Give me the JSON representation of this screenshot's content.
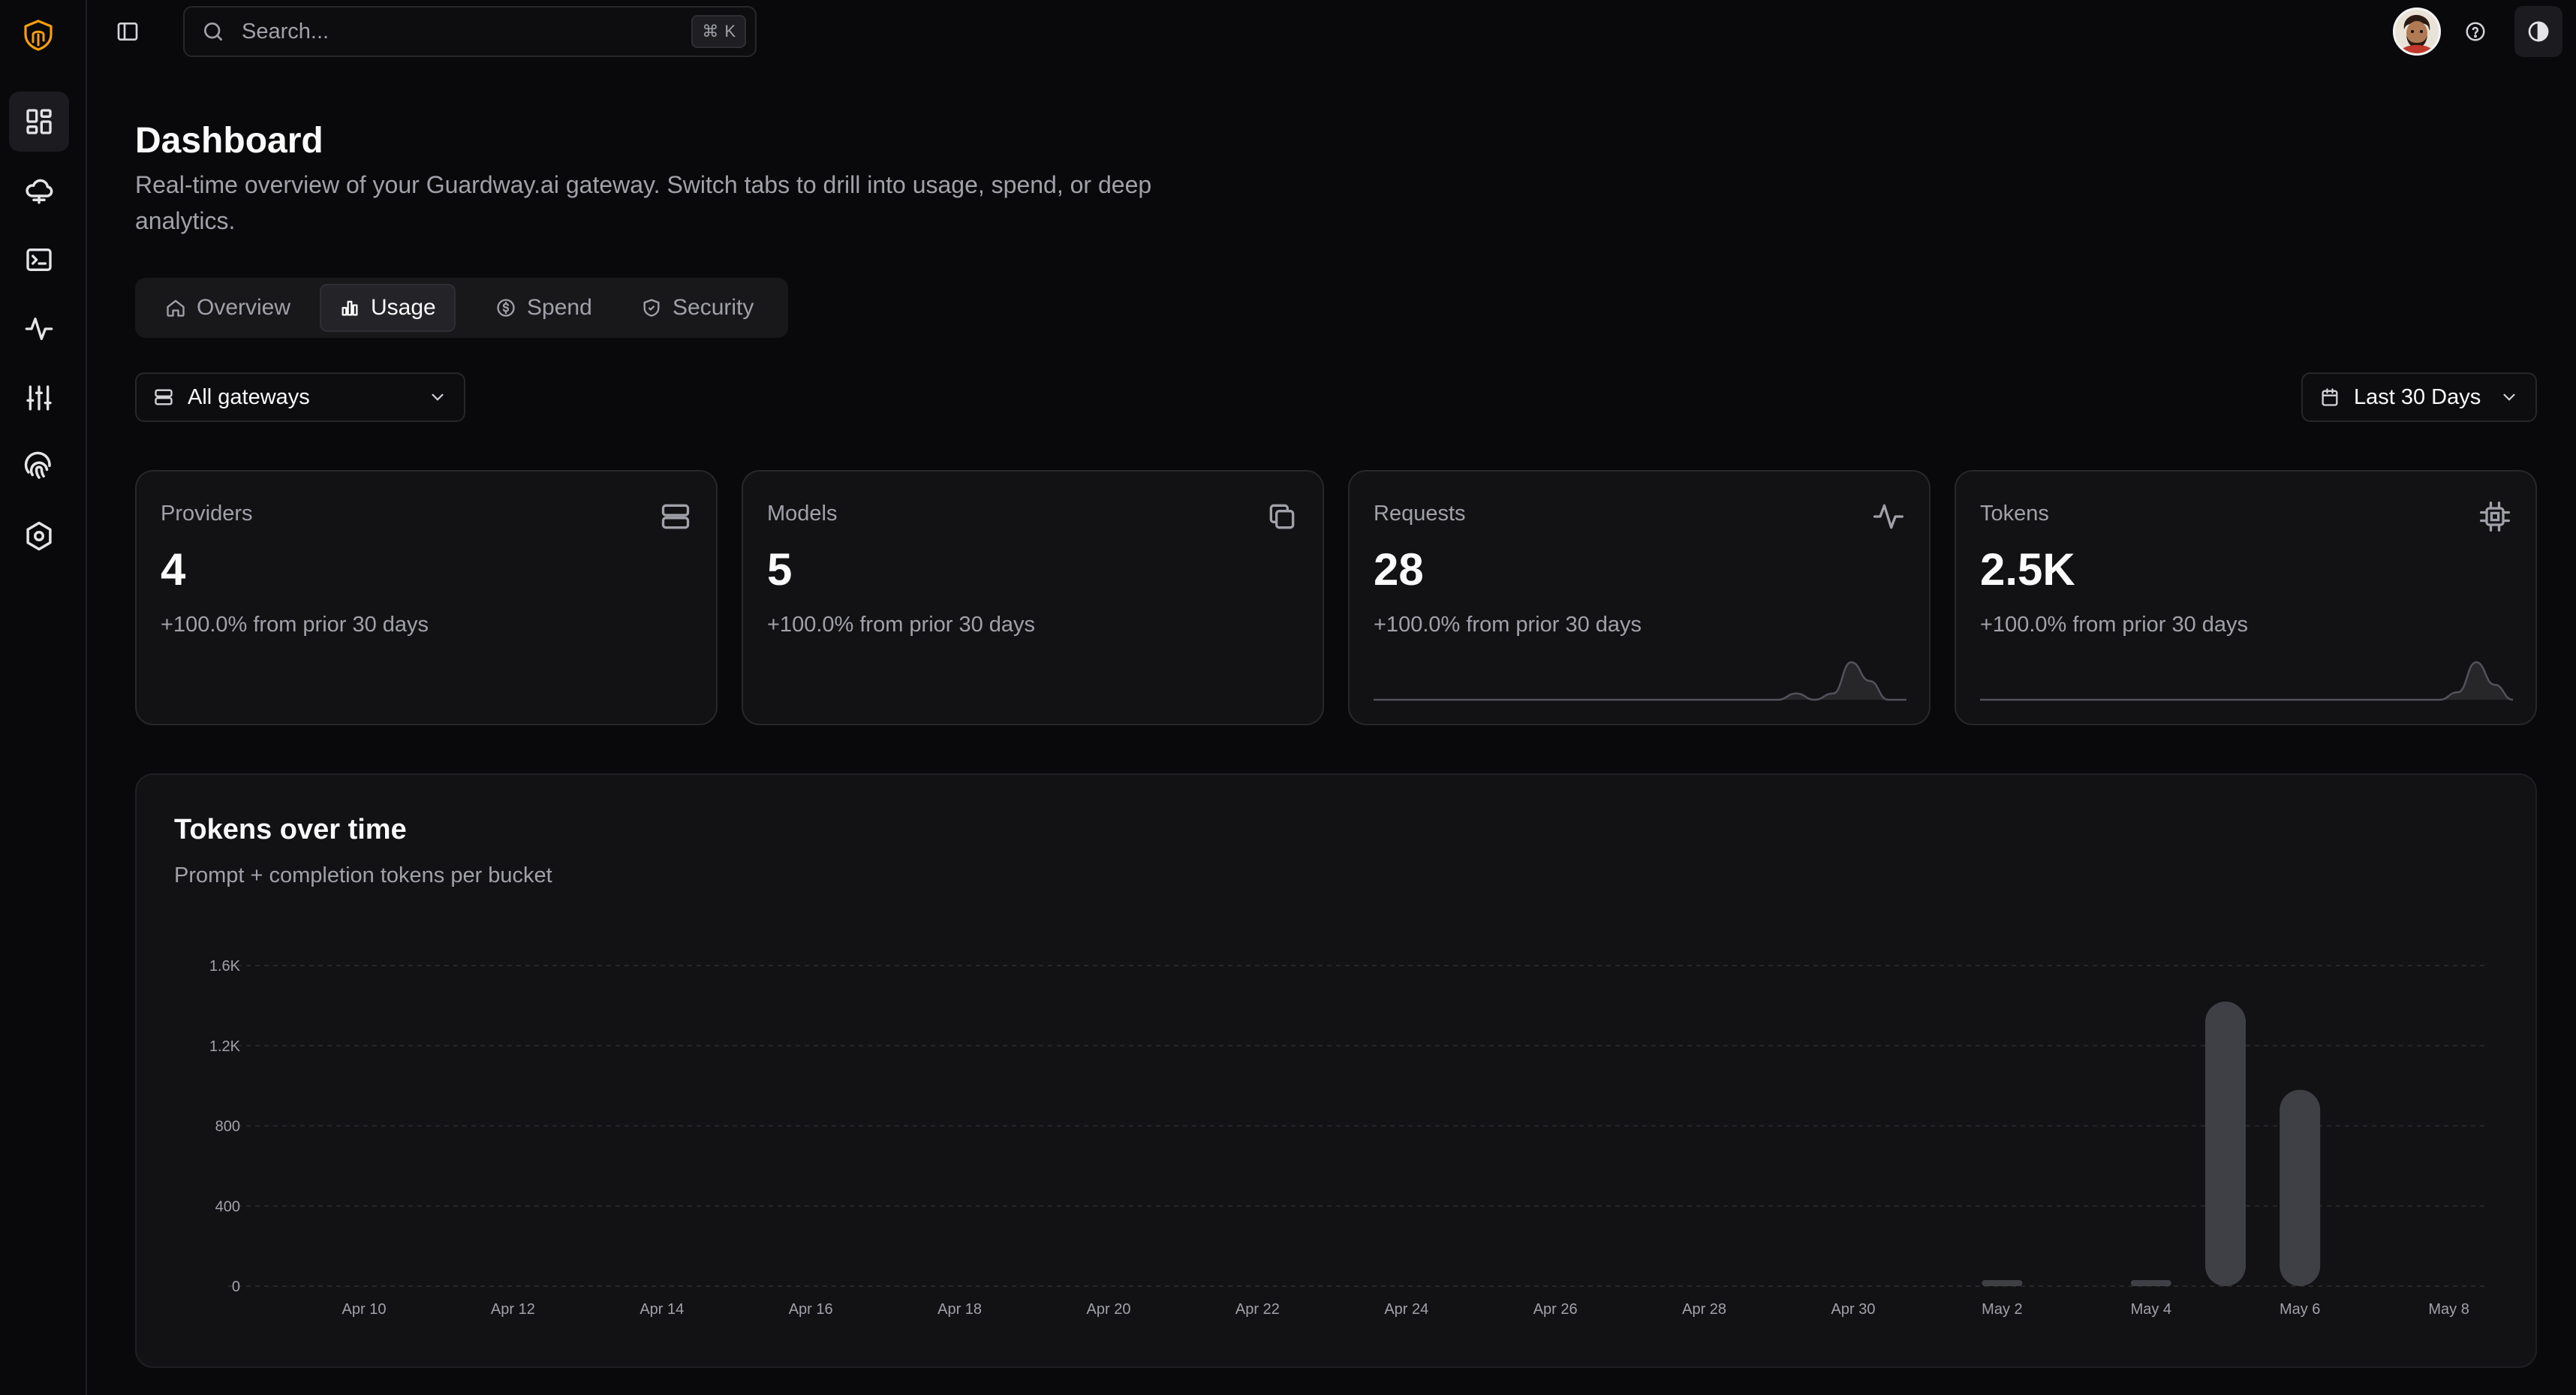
{
  "sidebar": {
    "logo": "guardway-logo-icon",
    "items": [
      {
        "icon": "dashboard-icon",
        "active": true
      },
      {
        "icon": "cloud-icon",
        "active": false
      },
      {
        "icon": "terminal-icon",
        "active": false
      },
      {
        "icon": "activity-icon",
        "active": false
      },
      {
        "icon": "sliders-icon",
        "active": false
      },
      {
        "icon": "fingerprint-icon",
        "active": false
      },
      {
        "icon": "settings-hex-icon",
        "active": false
      }
    ]
  },
  "topbar": {
    "search_placeholder": "Search...",
    "shortcut_symbol": "⌘",
    "shortcut_key": "K"
  },
  "page": {
    "title": "Dashboard",
    "subtitle": "Real-time overview of your Guardway.ai gateway. Switch tabs to drill into usage, spend, or deep analytics."
  },
  "tabs": [
    {
      "label": "Overview",
      "icon": "home-icon",
      "active": false
    },
    {
      "label": "Usage",
      "icon": "bar-chart-icon",
      "active": true
    },
    {
      "label": "Spend",
      "icon": "dollar-circle-icon",
      "active": false
    },
    {
      "label": "Security",
      "icon": "shield-icon",
      "active": false
    }
  ],
  "filters": {
    "gateway": "All gateways",
    "range": "Last 30 Days"
  },
  "cards": [
    {
      "label": "Providers",
      "value": "4",
      "change": "+100.0% from prior 30 days",
      "icon": "server-icon"
    },
    {
      "label": "Models",
      "value": "5",
      "change": "+100.0% from prior 30 days",
      "icon": "copy-icon"
    },
    {
      "label": "Requests",
      "value": "28",
      "change": "+100.0% from prior 30 days",
      "icon": "activity-icon"
    },
    {
      "label": "Tokens",
      "value": "2.5K",
      "change": "+100.0% from prior 30 days",
      "icon": "cpu-icon"
    }
  ],
  "chart_card": {
    "title": "Tokens over time",
    "subtitle": "Prompt + completion tokens per bucket"
  },
  "chart_data": {
    "type": "bar",
    "x": [
      "Apr 9",
      "Apr 10",
      "Apr 11",
      "Apr 12",
      "Apr 13",
      "Apr 14",
      "Apr 15",
      "Apr 16",
      "Apr 17",
      "Apr 18",
      "Apr 19",
      "Apr 20",
      "Apr 21",
      "Apr 22",
      "Apr 23",
      "Apr 24",
      "Apr 25",
      "Apr 26",
      "Apr 27",
      "Apr 28",
      "Apr 29",
      "Apr 30",
      "May 1",
      "May 2",
      "May 3",
      "May 4",
      "May 5",
      "May 6",
      "May 7",
      "May 8"
    ],
    "x_tick_labels": [
      "Apr 10",
      "Apr 12",
      "Apr 14",
      "Apr 16",
      "Apr 18",
      "Apr 20",
      "Apr 22",
      "Apr 24",
      "Apr 26",
      "Apr 28",
      "Apr 30",
      "May 2",
      "May 4",
      "May 6",
      "May 8"
    ],
    "values": [
      0,
      0,
      0,
      0,
      0,
      0,
      0,
      0,
      0,
      0,
      0,
      0,
      0,
      0,
      0,
      0,
      0,
      0,
      0,
      0,
      0,
      0,
      0,
      20,
      0,
      20,
      1420,
      980,
      0,
      0
    ],
    "yticks": [
      0,
      400,
      800,
      1200,
      1600
    ],
    "ytick_labels": [
      "0",
      "400",
      "800",
      "1.2K",
      "1.6K"
    ],
    "ylim": [
      0,
      1600
    ],
    "grid": true,
    "bar_color": "#3f3f46"
  },
  "sparklines": {
    "requests": [
      0,
      0,
      0,
      0,
      0,
      0,
      0,
      0,
      0,
      0,
      0,
      0,
      0,
      0,
      0,
      0,
      0,
      0,
      0,
      0,
      0,
      0,
      0,
      1,
      0,
      1,
      6,
      3,
      0,
      0
    ],
    "tokens": [
      0,
      0,
      0,
      0,
      0,
      0,
      0,
      0,
      0,
      0,
      0,
      0,
      0,
      0,
      0,
      0,
      0,
      0,
      0,
      0,
      0,
      0,
      0,
      0,
      0,
      0,
      1,
      5,
      2,
      0
    ]
  },
  "colors": {
    "background": "#09090b",
    "card": "#121215",
    "border": "#27272a",
    "muted_text": "#a1a1aa",
    "logo_accent": "#f59e0b"
  }
}
